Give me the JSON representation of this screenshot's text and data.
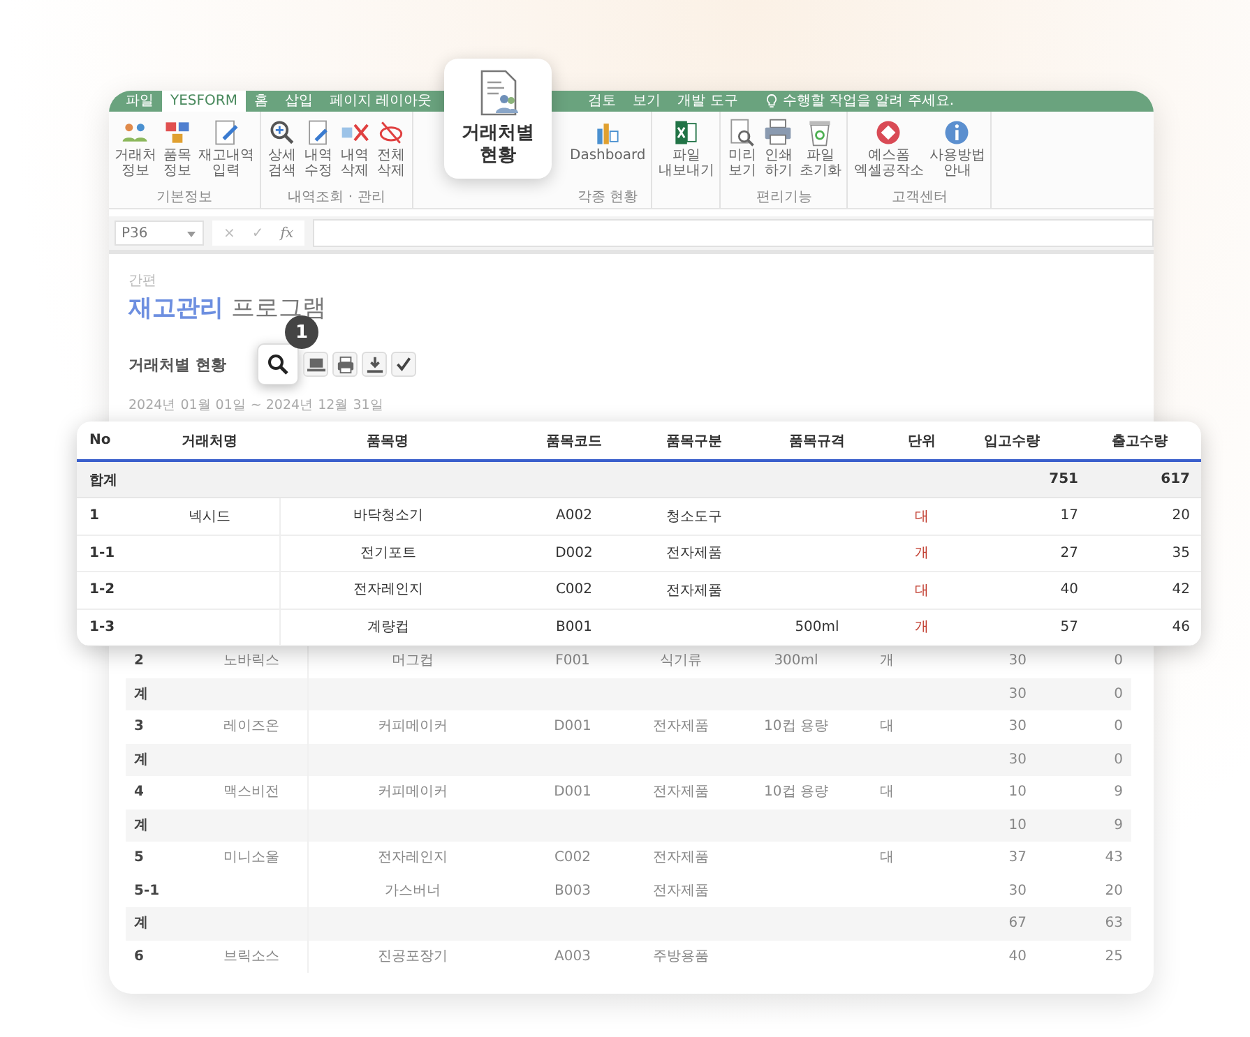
{
  "ribbon": {
    "tabs": [
      {
        "label": "파일",
        "selected": false
      },
      {
        "label": "YESFORM",
        "selected": true
      },
      {
        "label": "홈",
        "selected": false
      },
      {
        "label": "삽입",
        "selected": false
      },
      {
        "label": "페이지 레이아웃",
        "selected": false
      },
      {
        "label": "검토",
        "selected": false
      },
      {
        "label": "보기",
        "selected": false
      },
      {
        "label": "개발 도구",
        "selected": false
      }
    ],
    "tell_me": "수행할 작업을 알려 주세요.",
    "groups": [
      {
        "label": "기본정보",
        "buttons": [
          {
            "lines": [
              "거래처",
              "정보"
            ]
          },
          {
            "lines": [
              "품목",
              "정보"
            ]
          },
          {
            "lines": [
              "재고내역",
              "입력"
            ]
          }
        ]
      },
      {
        "label": "내역조회 · 관리",
        "buttons": [
          {
            "lines": [
              "상세",
              "검색"
            ]
          },
          {
            "lines": [
              "내역",
              "수정"
            ]
          },
          {
            "lines": [
              "내역",
              "삭제"
            ]
          },
          {
            "lines": [
              "전체",
              "삭제"
            ]
          }
        ]
      },
      {
        "label": "각종 현황",
        "buttons": [
          {
            "lines": [
              "Dashboard"
            ]
          }
        ]
      },
      {
        "buttons": [
          {
            "lines": [
              "파일",
              "내보내기"
            ]
          }
        ]
      },
      {
        "label": "편리기능",
        "buttons": [
          {
            "lines": [
              "미리",
              "보기"
            ]
          },
          {
            "lines": [
              "인쇄",
              "하기"
            ]
          },
          {
            "lines": [
              "파일",
              "초기화"
            ]
          }
        ]
      },
      {
        "label": "고객센터",
        "buttons": [
          {
            "lines": [
              "예스폼",
              "엑셀공작소"
            ]
          },
          {
            "lines": [
              "사용방법",
              "안내"
            ]
          }
        ]
      }
    ]
  },
  "callout": {
    "label": "거래처별 현황"
  },
  "formula_bar": {
    "name_box": "P36",
    "cancel": "×",
    "enter": "✓",
    "fx": "fx"
  },
  "sheet": {
    "subtitle": "간편",
    "title_accent": "재고관리",
    "title_rest": "프로그램",
    "section": "거래처별 현황",
    "step_badge": "1",
    "date_range": "2024년 01월 01일 ~ 2024년 12월 31일"
  },
  "popup_table": {
    "columns": [
      "No",
      "거래처명",
      "품목명",
      "품목코드",
      "품목구분",
      "품목규격",
      "단위",
      "입고수량",
      "출고수량"
    ],
    "total": {
      "no": "합계",
      "in": "751",
      "out": "617"
    },
    "rows": [
      {
        "no": "1",
        "vendor": "넥시드",
        "item": "바닥청소기",
        "code": "A002",
        "category": "청소도구",
        "unit": "대",
        "in": "17",
        "out": "20"
      },
      {
        "no": "1-1",
        "item": "전기포트",
        "code": "D002",
        "category": "전자제품",
        "unit": "개",
        "in": "27",
        "out": "35"
      },
      {
        "no": "1-2",
        "item": "전자레인지",
        "code": "C002",
        "category": "전자제품",
        "unit": "대",
        "in": "40",
        "out": "42"
      },
      {
        "no": "1-3",
        "item": "계량컵",
        "code": "B001",
        "spec": "500ml",
        "unit": "개",
        "in": "57",
        "out": "46"
      }
    ]
  },
  "sheet_table": {
    "rows": [
      {
        "kind": "item",
        "no": "2",
        "vendor": "노바릭스",
        "item": "머그컵",
        "code": "F001",
        "category": "식기류",
        "spec": "300ml",
        "unit": "개",
        "in": "30",
        "out": "0"
      },
      {
        "kind": "subtotal",
        "no": "계",
        "in": "30",
        "out": "0"
      },
      {
        "kind": "item",
        "no": "3",
        "vendor": "레이즈온",
        "item": "커피메이커",
        "code": "D001",
        "category": "전자제품",
        "spec": "10컵 용량",
        "unit": "대",
        "in": "30",
        "out": "0"
      },
      {
        "kind": "subtotal",
        "no": "계",
        "in": "30",
        "out": "0"
      },
      {
        "kind": "item",
        "no": "4",
        "vendor": "맥스비전",
        "item": "커피메이커",
        "code": "D001",
        "category": "전자제품",
        "spec": "10컵 용량",
        "unit": "대",
        "in": "10",
        "out": "9"
      },
      {
        "kind": "subtotal",
        "no": "계",
        "in": "10",
        "out": "9"
      },
      {
        "kind": "item",
        "no": "5",
        "vendor": "미니소울",
        "item": "전자레인지",
        "code": "C002",
        "category": "전자제품",
        "unit": "대",
        "in": "37",
        "out": "43"
      },
      {
        "kind": "item",
        "no": "5-1",
        "item": "가스버너",
        "code": "B003",
        "category": "전자제품",
        "in": "30",
        "out": "20"
      },
      {
        "kind": "subtotal",
        "no": "계",
        "in": "67",
        "out": "63"
      },
      {
        "kind": "item",
        "no": "6",
        "vendor": "브릭소스",
        "item": "진공포장기",
        "code": "A003",
        "category": "주방용품",
        "in": "40",
        "out": "25"
      }
    ]
  }
}
